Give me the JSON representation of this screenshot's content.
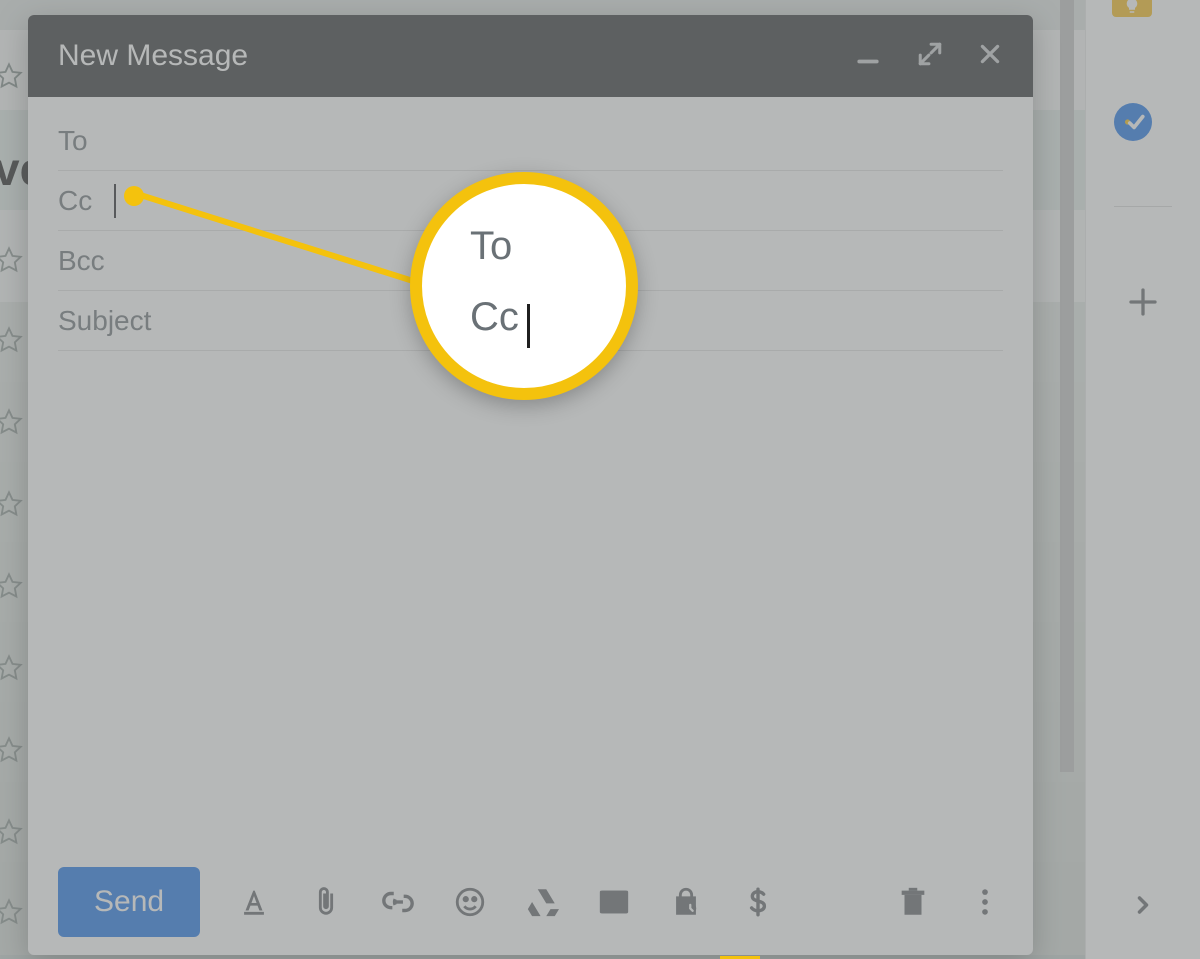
{
  "compose": {
    "title": "New Message",
    "fields": {
      "to": "To",
      "cc": "Cc",
      "bcc": "Bcc",
      "subject": "Subject"
    },
    "send_label": "Send"
  },
  "callout": {
    "to": "To",
    "cc": "Cc"
  },
  "bg": {
    "partial_word": "ve"
  }
}
